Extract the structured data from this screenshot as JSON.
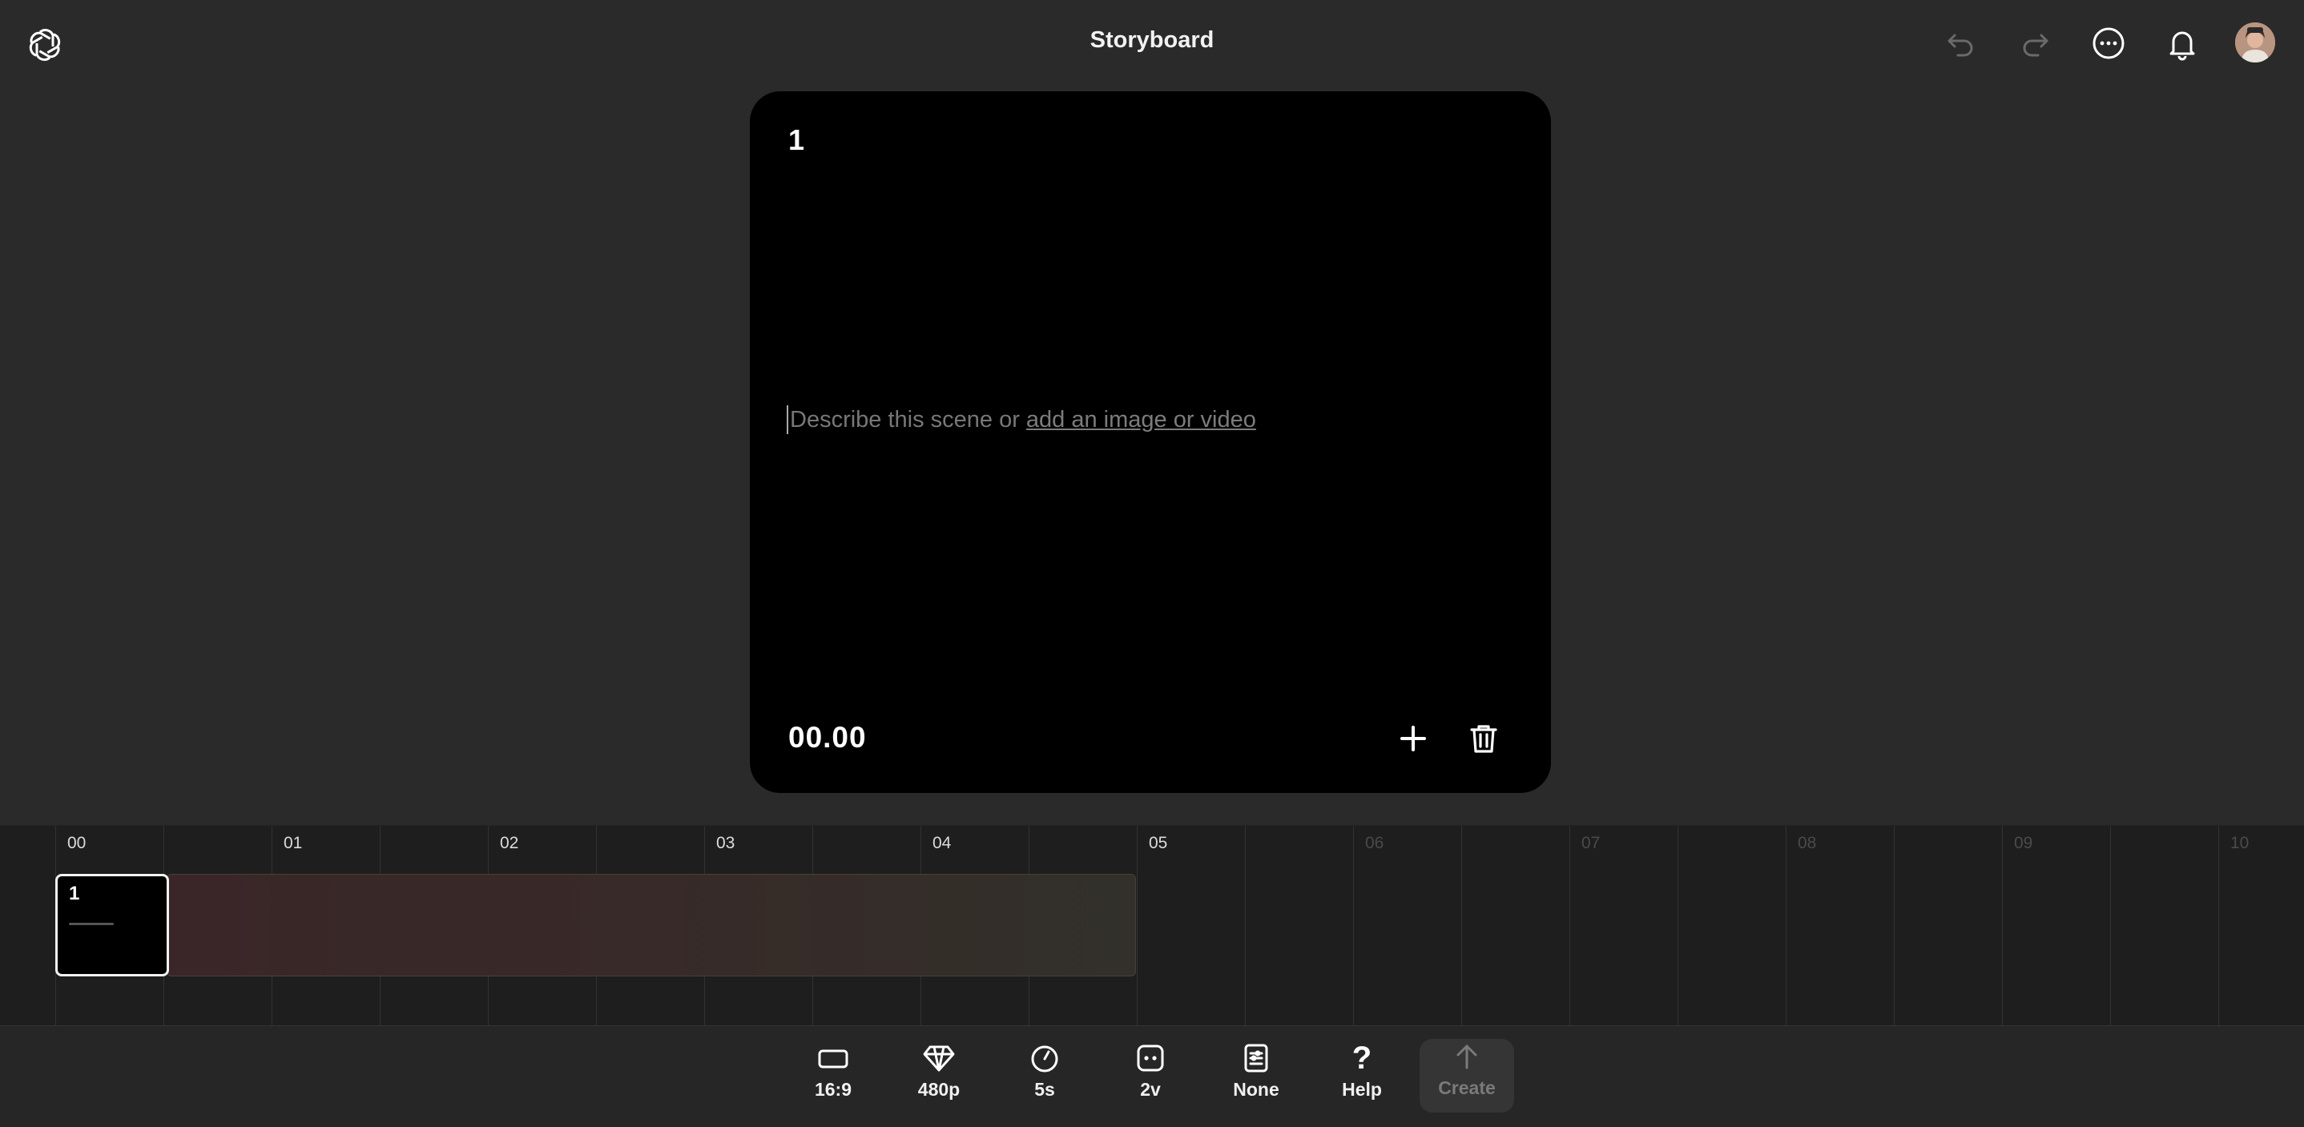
{
  "header": {
    "title": "Storyboard"
  },
  "scene": {
    "number": "1",
    "prompt_text": "Describe this scene or",
    "prompt_link": "add an image or video",
    "timecode": "00.00"
  },
  "timeline": {
    "ticks": [
      "00",
      "01",
      "02",
      "03",
      "04",
      "05",
      "06",
      "07",
      "08",
      "09",
      "10"
    ],
    "clip": {
      "number": "1",
      "duration_seconds": 5
    }
  },
  "toolbar": {
    "aspect_label": "16:9",
    "resolution_label": "480p",
    "duration_label": "5s",
    "variations_label": "2v",
    "preset_label": "None",
    "help_label": "Help",
    "create_label": "Create"
  }
}
